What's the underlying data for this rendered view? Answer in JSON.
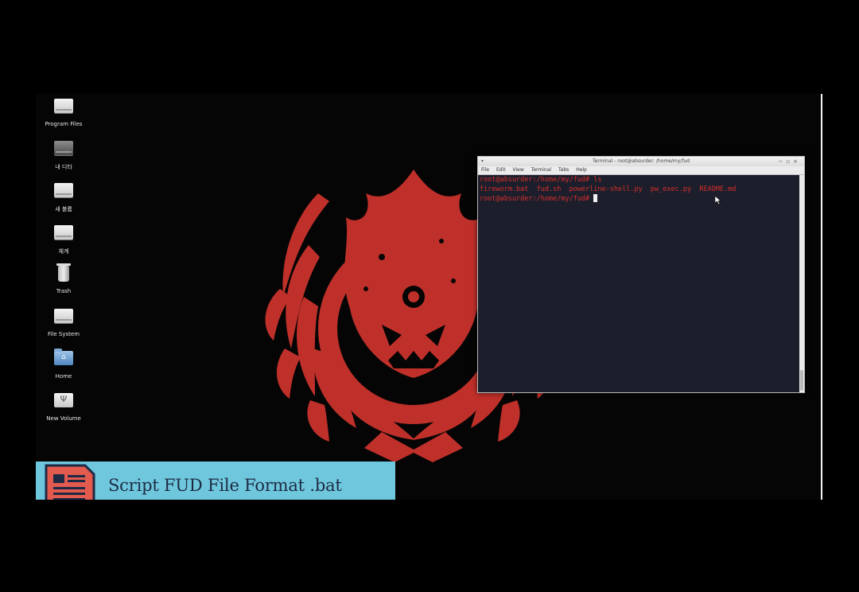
{
  "desktop": {
    "icons": [
      {
        "label": "Program Files",
        "icon": "drive-icon"
      },
      {
        "label": "내 디타",
        "icon": "dark-drive-icon"
      },
      {
        "label": "새 볼륨",
        "icon": "drive-icon"
      },
      {
        "label": "체계",
        "icon": "drive-icon"
      },
      {
        "label": "Trash",
        "icon": "trash-icon"
      },
      {
        "label": "File System",
        "icon": "drive-icon"
      },
      {
        "label": "Home",
        "icon": "home-folder-icon"
      },
      {
        "label": "New Volume",
        "icon": "usb-drive-icon"
      }
    ]
  },
  "terminal": {
    "title": "Terminal - root@absurder: /home/my/fud",
    "menu": [
      "File",
      "Edit",
      "View",
      "Terminal",
      "Tabs",
      "Help"
    ],
    "lines": [
      "root@absurder:/home/my/fud# ls",
      "fireworm.bat  fud.sh  powerline-shell.py  pw_exec.py  README.md",
      "root@absurder:/home/my/fud# "
    ],
    "text_color": "#d72d2d",
    "background": "#1c1f2b"
  },
  "banner": {
    "title": "Script FUD File Format .bat",
    "background": "#6ec7dc"
  },
  "colors": {
    "emblem_red": "#c0302a"
  }
}
